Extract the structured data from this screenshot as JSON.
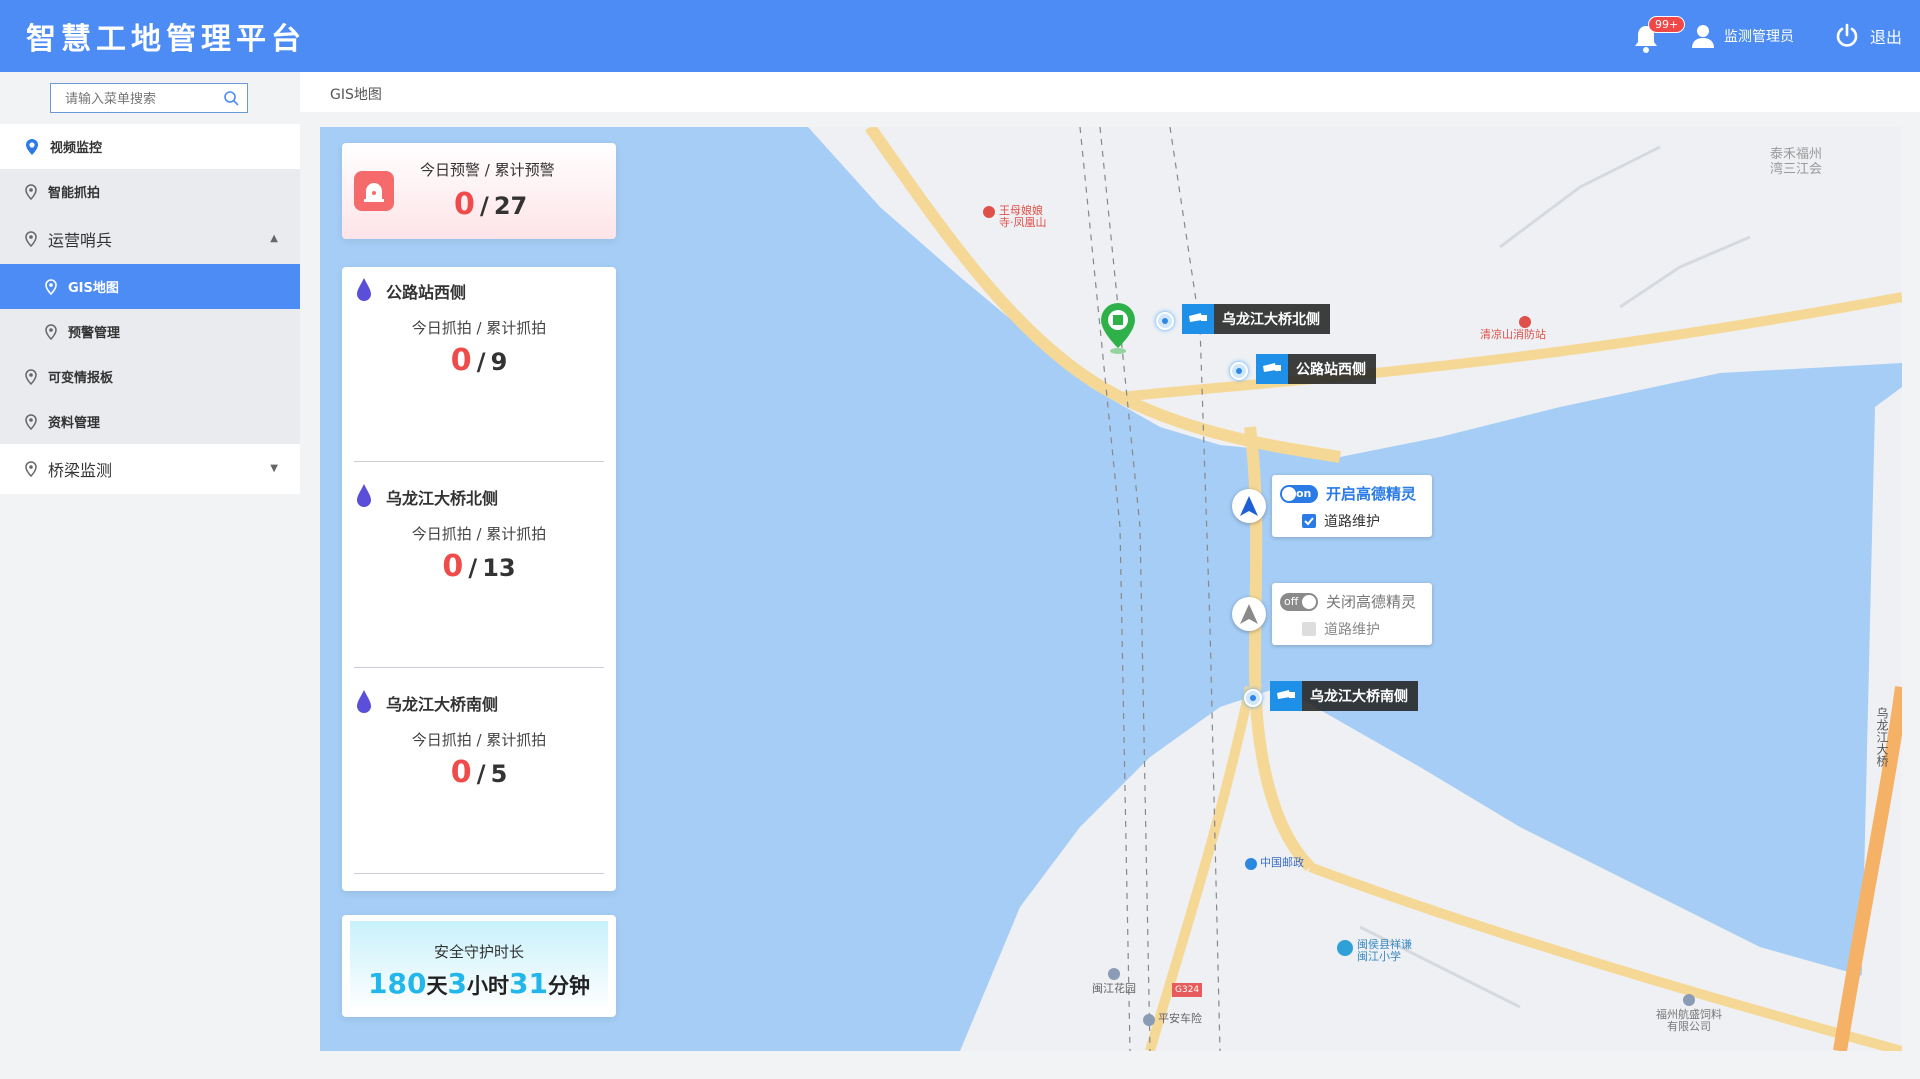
{
  "app": {
    "title": "智慧工地管理平台"
  },
  "header": {
    "notification_count": "99+",
    "user_name": "监测管理员",
    "logout_label": "退出"
  },
  "sidebar": {
    "search_placeholder": "请输入菜单搜索",
    "items": [
      {
        "label": "视频监控"
      },
      {
        "label": "智能抓拍"
      },
      {
        "label": "运营哨兵"
      },
      {
        "label": "GIS地图"
      },
      {
        "label": "预警管理"
      },
      {
        "label": "可变情报板"
      },
      {
        "label": "资料管理"
      },
      {
        "label": "桥梁监测"
      }
    ]
  },
  "breadcrumb": {
    "current": "GIS地图"
  },
  "warning": {
    "title": "今日预警 / 累计预警",
    "today": "0",
    "total": "27",
    "sep": "/"
  },
  "sites": [
    {
      "name": "公路站西侧",
      "caption": "今日抓拍 / 累计抓拍",
      "today": "0",
      "total": "9"
    },
    {
      "name": "乌龙江大桥北侧",
      "caption": "今日抓拍 / 累计抓拍",
      "today": "0",
      "total": "13"
    },
    {
      "name": "乌龙江大桥南侧",
      "caption": "今日抓拍 / 累计抓拍",
      "today": "0",
      "total": "5"
    }
  ],
  "safety": {
    "title": "安全守护时长",
    "days": "180",
    "day_unit": "天",
    "hours": "3",
    "hour_unit": "小时",
    "minutes": "31",
    "minute_unit": "分钟"
  },
  "map": {
    "cameras": [
      {
        "label": "乌龙江大桥北侧"
      },
      {
        "label": "公路站西侧"
      },
      {
        "label": "乌龙江大桥南侧"
      }
    ],
    "control_on": {
      "switch": "on",
      "title": "开启高德精灵",
      "option": "道路维护"
    },
    "control_off": {
      "switch": "off",
      "title": "关闭高德精灵",
      "option": "道路维护"
    },
    "pois": {
      "temple_l1": "王母娘娘",
      "temple_l2": "寺·凤凰山",
      "fire": "清凉山消防站",
      "top_right_l1": "泰禾福州",
      "top_right_l2": "湾三江会",
      "post": "中国邮政",
      "school_l1": "闽侯县祥谦",
      "school_l2": "闽江小学",
      "garden": "闽江花园",
      "road": "G324",
      "insurance": "平安车险",
      "company_l1": "福州航盛饲料",
      "company_l2": "有限公司",
      "bridge": "乌龙江大桥"
    }
  },
  "colors": {
    "primary": "#4d8cf5",
    "warning_number": "#f04b4b",
    "time_number": "#22b6ea",
    "water": "#a5cdf5",
    "land": "#f2f3f5"
  }
}
